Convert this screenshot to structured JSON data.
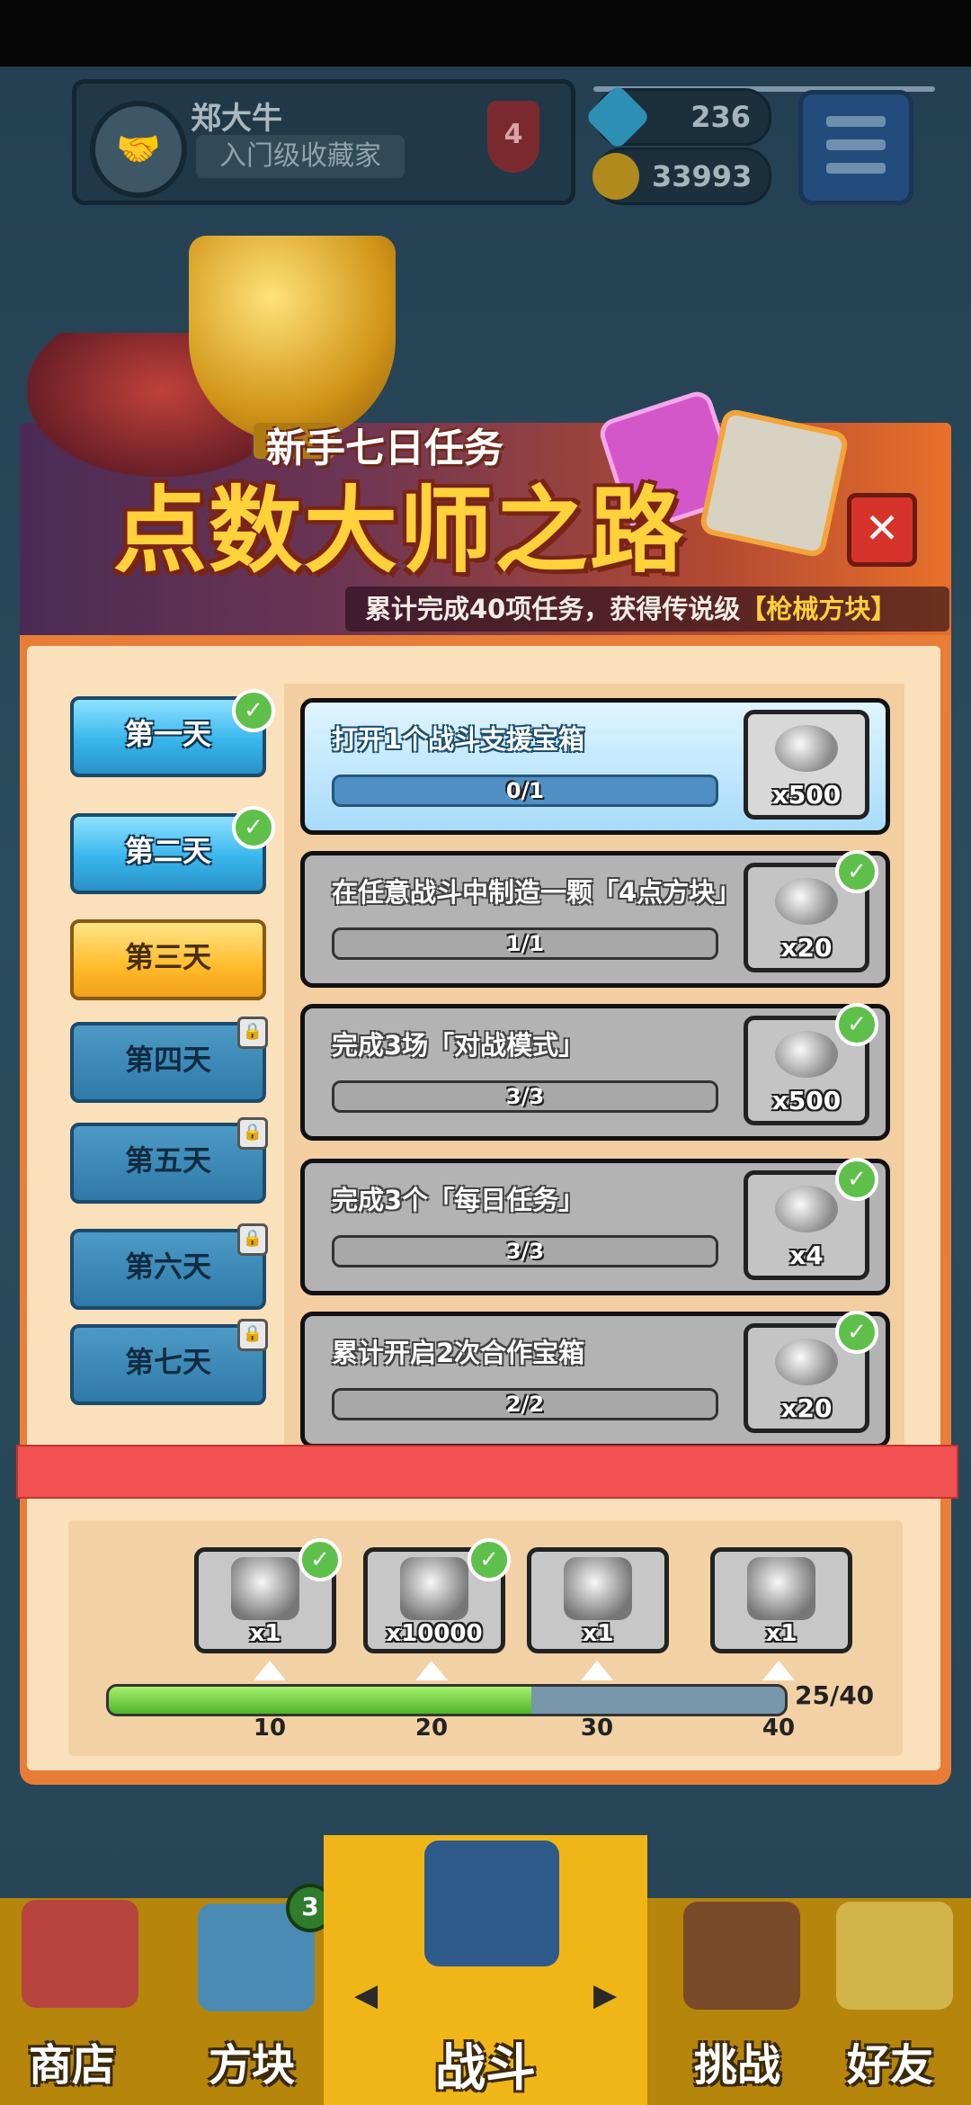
{
  "header": {
    "username": "郑大牛",
    "title_badge": "入门级收藏家",
    "rank": "4",
    "gems": "236",
    "coins": "33993"
  },
  "banner": {
    "subtitle": "新手七日任务",
    "title": "点数大师之路",
    "note_prefix": "累计完成40项任务，获得传说级",
    "note_highlight": "【枪械方块】",
    "close": "✕"
  },
  "days": [
    {
      "label": "第一天",
      "state": "done"
    },
    {
      "label": "第二天",
      "state": "done"
    },
    {
      "label": "第三天",
      "state": "current"
    },
    {
      "label": "第四天",
      "state": "locked"
    },
    {
      "label": "第五天",
      "state": "locked"
    },
    {
      "label": "第六天",
      "state": "locked"
    },
    {
      "label": "第七天",
      "state": "locked"
    }
  ],
  "tasks": [
    {
      "text": "打开1个战斗支援宝箱",
      "progress": "0/1",
      "fraction": 0,
      "reward_qty": "x500",
      "reward_icon": "coin-pile-icon",
      "active": true,
      "claimed": false
    },
    {
      "text": "在任意战斗中制造一颗「4点方块」",
      "progress": "1/1",
      "fraction": 1,
      "reward_qty": "x20",
      "reward_icon": "gem-pile-icon",
      "active": false,
      "claimed": true
    },
    {
      "text": "完成3场「对战模式」",
      "progress": "3/3",
      "fraction": 1,
      "reward_qty": "x500",
      "reward_icon": "coin-pile-icon",
      "active": false,
      "claimed": true
    },
    {
      "text": "完成3个「每日任务」",
      "progress": "3/3",
      "fraction": 1,
      "reward_qty": "x4",
      "reward_icon": "chest-icon",
      "active": false,
      "claimed": true
    },
    {
      "text": "累计开启2次合作宝箱",
      "progress": "2/2",
      "fraction": 1,
      "reward_qty": "x20",
      "reward_icon": "gem-pile-icon",
      "active": false,
      "claimed": true
    }
  ],
  "milestones": {
    "rewards": [
      {
        "qty": "x1",
        "icon": "character-icon",
        "claimed": true,
        "threshold": "10"
      },
      {
        "qty": "x10000",
        "icon": "coin-pile-icon",
        "claimed": true,
        "threshold": "20"
      },
      {
        "qty": "x1",
        "icon": "treasure-chest-icon",
        "claimed": false,
        "threshold": "30"
      },
      {
        "qty": "x1",
        "icon": "gun-cube-icon",
        "claimed": false,
        "threshold": "40"
      }
    ],
    "progress_text": "25/40",
    "progress_fraction": 0.625
  },
  "nav": {
    "shop": "商店",
    "cubes": "方块",
    "cubes_badge": "3",
    "battle": "战斗",
    "challenge": "挑战",
    "friends": "好友"
  },
  "colors": {
    "accent_blue": "#38b6ec",
    "accent_gold": "#ffbb2a",
    "check_green": "#5ec04a",
    "strip_red": "#f15151"
  }
}
